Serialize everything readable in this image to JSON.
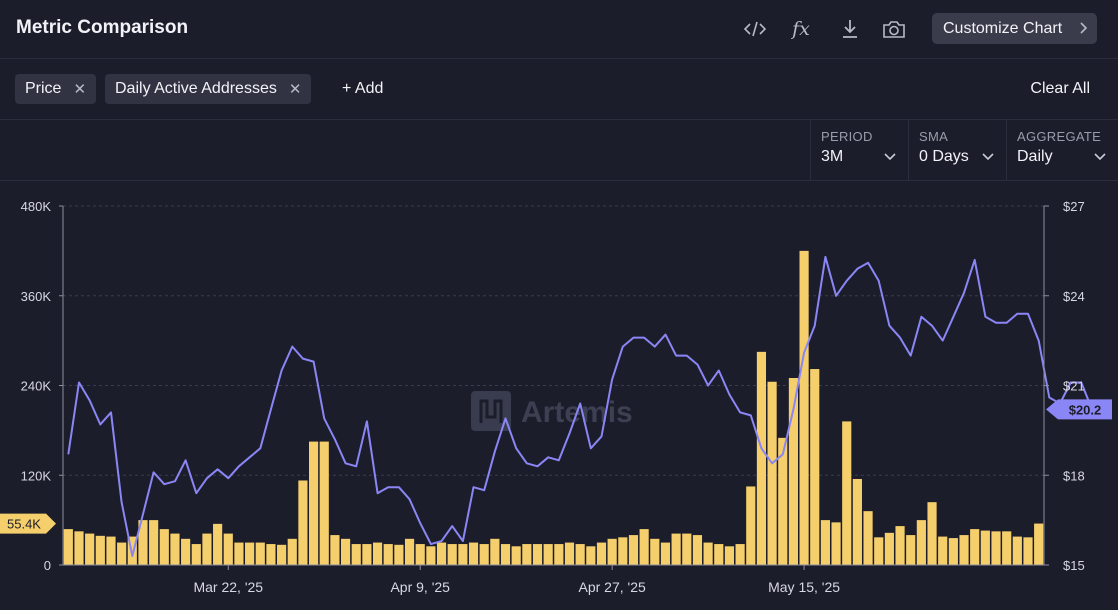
{
  "header": {
    "title": "Metric Comparison",
    "tools": [
      {
        "icon": "code-icon",
        "glyph": "</>"
      },
      {
        "icon": "function-icon",
        "glyph": "fx"
      },
      {
        "icon": "download-icon",
        "glyph": "⤓"
      },
      {
        "icon": "camera-icon",
        "glyph": "📷"
      }
    ],
    "customize_label": "Customize Chart"
  },
  "metrics": {
    "chips": [
      "Price",
      "Daily Active Addresses"
    ],
    "add_label": "+ Add",
    "clear_label": "Clear All"
  },
  "controls": {
    "period": {
      "label": "PERIOD",
      "value": "3M"
    },
    "sma": {
      "label": "SMA",
      "value": "0 Days"
    },
    "aggregate": {
      "label": "AGGREGATE",
      "value": "Daily"
    }
  },
  "watermark": "Artemis",
  "chart_data": {
    "type": "bar+line",
    "x_tick_labels": [
      "Mar 22, '25",
      "Apr 9, '25",
      "Apr 27, '25",
      "May 15, '25"
    ],
    "x_tick_indices": [
      15,
      33,
      51,
      69
    ],
    "left_axis": {
      "ticks": [
        "0",
        "120K",
        "240K",
        "360K",
        "480K"
      ],
      "ylim": [
        0,
        480000
      ]
    },
    "right_axis": {
      "ticks": [
        "$15",
        "$18",
        "$21",
        "$24",
        "$27"
      ],
      "ylim": [
        15,
        27
      ]
    },
    "grid": true,
    "series": [
      {
        "name": "Daily Active Addresses",
        "type": "bar",
        "color": "#f4cf6b",
        "current_label": "55.4K",
        "values": [
          48000,
          45000,
          42000,
          39000,
          38000,
          30000,
          38000,
          60000,
          60000,
          48000,
          42000,
          35000,
          28000,
          42000,
          55000,
          42000,
          30000,
          30000,
          30000,
          28000,
          27000,
          35000,
          113000,
          165000,
          165000,
          40000,
          35000,
          28000,
          28000,
          30000,
          28000,
          27000,
          35000,
          28000,
          25000,
          30000,
          28000,
          28000,
          30000,
          28000,
          35000,
          28000,
          25000,
          28000,
          28000,
          28000,
          28000,
          30000,
          28000,
          25000,
          30000,
          35000,
          37000,
          40000,
          48000,
          35000,
          30000,
          42000,
          42000,
          40000,
          30000,
          28000,
          25000,
          28000,
          105000,
          285000,
          245000,
          170000,
          250000,
          420000,
          262000,
          60000,
          57000,
          192000,
          115000,
          72000,
          37000,
          43000,
          52000,
          40000,
          60000,
          84000,
          38000,
          36000,
          40000,
          48000,
          46000,
          45000,
          45000,
          38000,
          37000,
          55400
        ]
      },
      {
        "name": "Price",
        "type": "line",
        "color": "#8b86f5",
        "current_label": "$20.2",
        "values": [
          18.7,
          21.1,
          20.5,
          19.7,
          20.1,
          17.1,
          15.3,
          16.7,
          18.1,
          17.7,
          17.8,
          18.5,
          17.4,
          17.9,
          18.2,
          17.9,
          18.3,
          18.6,
          18.9,
          20.2,
          21.5,
          22.3,
          21.9,
          21.8,
          19.9,
          19.2,
          18.4,
          18.3,
          19.8,
          17.4,
          17.6,
          17.6,
          17.2,
          16.4,
          15.7,
          15.8,
          16.3,
          15.8,
          17.6,
          17.5,
          18.8,
          19.9,
          18.9,
          18.4,
          18.3,
          18.6,
          18.5,
          19.4,
          20.4,
          18.9,
          19.3,
          21.2,
          22.3,
          22.6,
          22.6,
          22.3,
          22.7,
          22.0,
          22.0,
          21.7,
          21.0,
          21.5,
          20.7,
          20.1,
          20.0,
          18.9,
          18.4,
          18.7,
          20.2,
          22.1,
          23.0,
          25.3,
          24.0,
          24.5,
          24.9,
          25.1,
          24.5,
          23.0,
          22.6,
          22.0,
          23.3,
          23.0,
          22.5,
          23.3,
          24.1,
          25.2,
          23.3,
          23.1,
          23.1,
          23.4,
          23.4,
          22.5,
          20.6,
          20.4,
          21.1,
          21.1,
          20.2
        ]
      }
    ]
  }
}
